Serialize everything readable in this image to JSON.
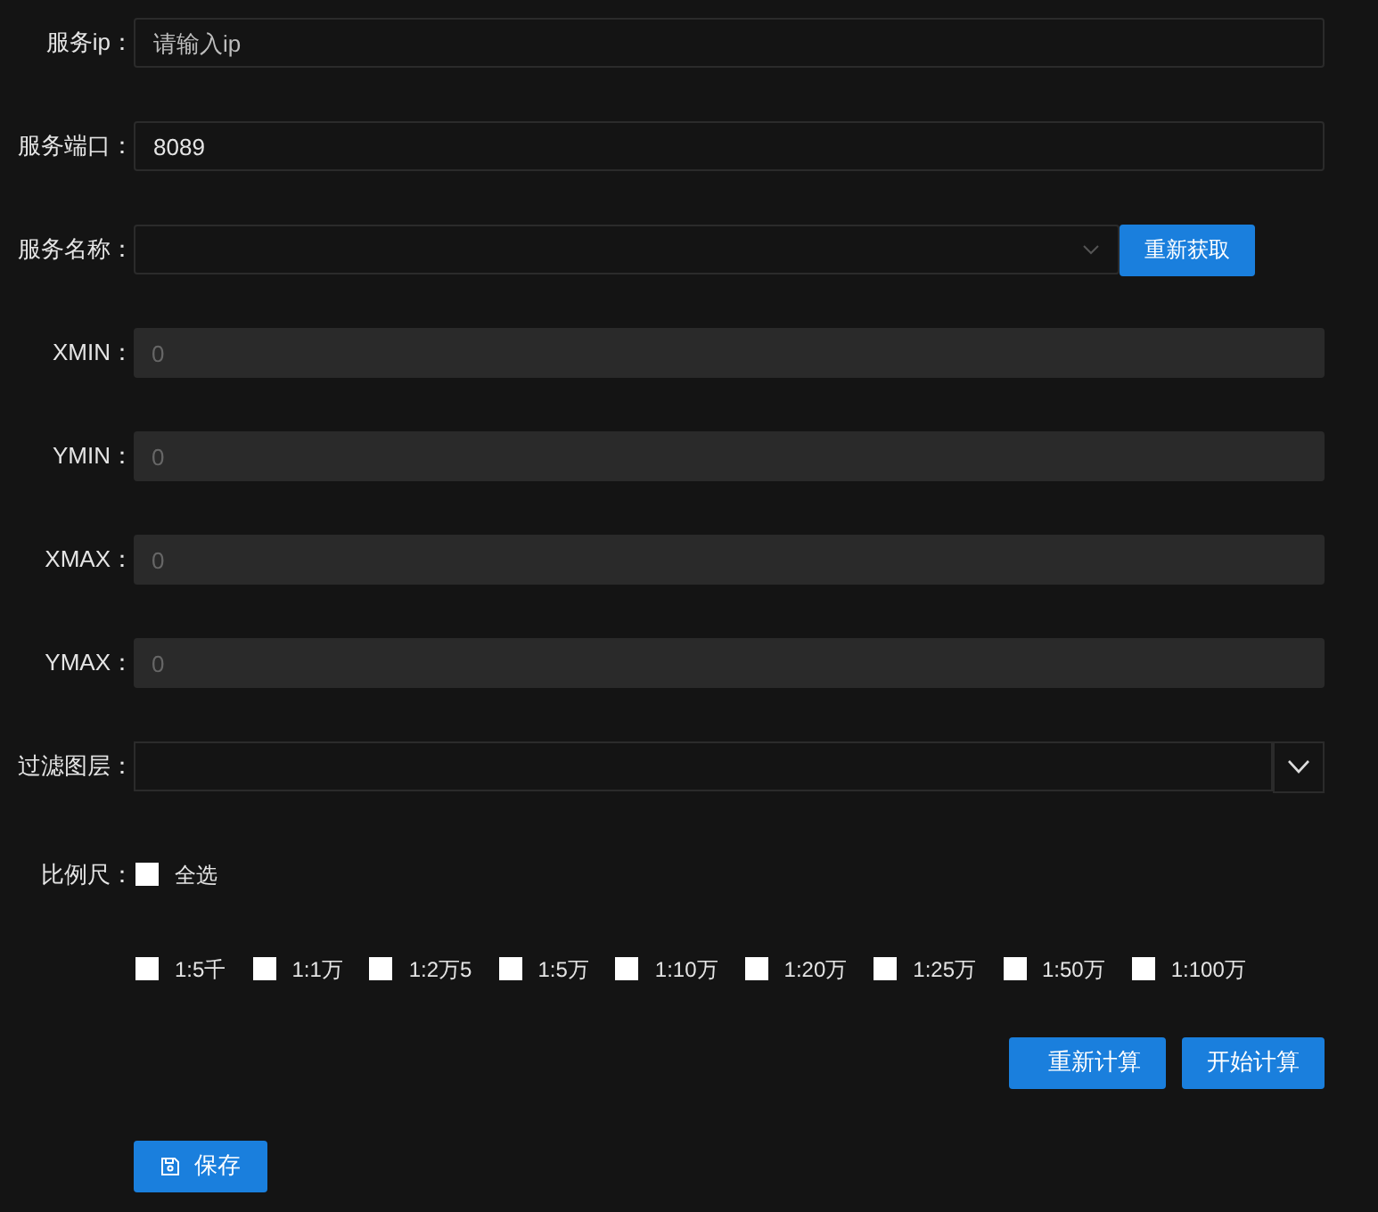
{
  "fields": [
    {
      "kind": "text",
      "label": "服务ip：",
      "placeholder": "请输入ip"
    },
    {
      "kind": "text",
      "label": "服务端口：",
      "value": "8089"
    },
    {
      "kind": "select",
      "label": "服务名称：",
      "button": "重新获取"
    },
    {
      "kind": "disabled",
      "label": "XMIN：",
      "placeholder": "0"
    },
    {
      "kind": "disabled",
      "label": "YMIN：",
      "placeholder": "0"
    },
    {
      "kind": "disabled",
      "label": "XMAX：",
      "placeholder": "0"
    },
    {
      "kind": "disabled",
      "label": "YMAX：",
      "placeholder": "0"
    },
    {
      "kind": "combo",
      "label": "过滤图层："
    }
  ],
  "scale": {
    "label": "比例尺：",
    "select_all": {
      "label": "全选",
      "checked": false
    },
    "options": [
      {
        "label": "1:5千",
        "checked": false
      },
      {
        "label": "1:1万",
        "checked": false
      },
      {
        "label": "1:2万5",
        "checked": false
      },
      {
        "label": "1:5万",
        "checked": false
      },
      {
        "label": "1:10万",
        "checked": false
      },
      {
        "label": "1:20万",
        "checked": false
      },
      {
        "label": "1:25万",
        "checked": false
      },
      {
        "label": "1:50万",
        "checked": false
      },
      {
        "label": "1:100万",
        "checked": false
      }
    ]
  },
  "actions": [
    "重新计算",
    "开始计算"
  ],
  "save_button": "保存"
}
